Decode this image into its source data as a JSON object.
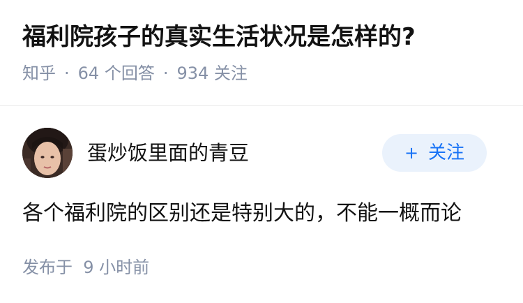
{
  "question": {
    "title": "福利院孩子的真实生活状况是怎样的?",
    "source": "知乎",
    "answers_count": "64",
    "answers_label": "个回答",
    "followers_count": "934",
    "followers_label": "关注",
    "separator": "·"
  },
  "answer": {
    "author": {
      "name": "蛋炒饭里面的青豆",
      "avatar_icon": "user-avatar-photo"
    },
    "follow_button": {
      "icon": "+",
      "label": "关注"
    },
    "content": "各个福利院的区别还是特别大的，不能一概而论",
    "publish_label": "发布于",
    "publish_time": "9 小时前"
  },
  "colors": {
    "text_primary": "#121212",
    "text_secondary": "#8590a6",
    "accent": "#1772f6",
    "button_bg": "#eaf2fc",
    "divider": "#ececec"
  }
}
